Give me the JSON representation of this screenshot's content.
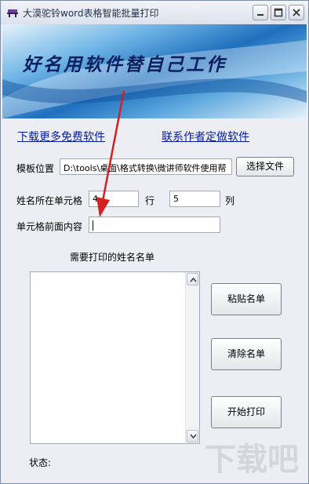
{
  "window": {
    "title": "大漠驼铃word表格智能批量打印"
  },
  "banner": {
    "slogan": "好名用软件替自己工作"
  },
  "links": {
    "download_more": "下载更多免费软件",
    "contact_author": "联系作者定做软件"
  },
  "template": {
    "label": "模板位置",
    "path": "D:\\tools\\桌面\\格式转换\\微讲师软件使用帮",
    "choose_button": "选择文件"
  },
  "cell": {
    "label": "姓名所在单元格",
    "row_value": "4",
    "row_label": "行",
    "col_value": "5",
    "col_label": "列"
  },
  "prefix": {
    "label": "单元格前面内容",
    "value": ""
  },
  "namelist": {
    "label": "需要打印的姓名名单"
  },
  "buttons": {
    "paste": "粘贴名单",
    "clear": "清除名单",
    "print": "开始打印"
  },
  "status": {
    "label": "状态:"
  },
  "watermark": {
    "text": "下载吧"
  },
  "colors": {
    "link": "#0A1E9C",
    "arrow": "#D42020",
    "banner_dark": "#1F6FBE"
  }
}
